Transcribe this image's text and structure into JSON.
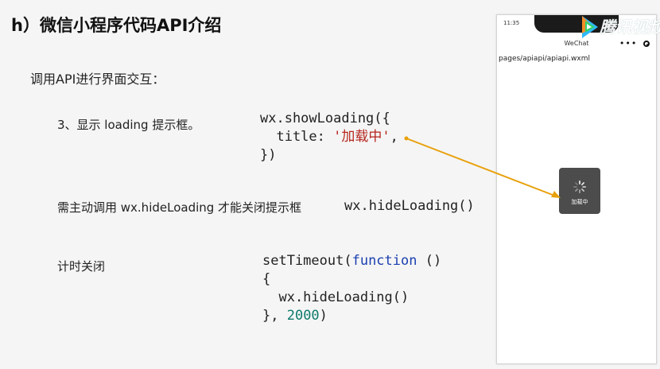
{
  "slide": {
    "title": "h）微信小程序代码API介绍",
    "subtitle": "调用API进行界面交互：",
    "items": [
      {
        "label": "3、显示 loading 提示框。"
      },
      {
        "label": "需主动调用 wx.hideLoading 才能关闭提示框"
      },
      {
        "label": "计时关闭"
      }
    ],
    "code": {
      "show_loading_l1": "wx.showLoading({",
      "show_loading_l2_key": "  title: ",
      "show_loading_l2_val": "'加载中'",
      "show_loading_l2_end": ",",
      "show_loading_l3": "})",
      "hide_loading": "wx.hideLoading()",
      "timeout_l1_a": "setTimeout(",
      "timeout_l1_kw": "function",
      "timeout_l1_b": " ()",
      "timeout_l2": "{",
      "timeout_l3": "  wx.hideLoading()",
      "timeout_l4_a": "}, ",
      "timeout_l4_num": "2000",
      "timeout_l4_b": ")"
    }
  },
  "phone": {
    "time": "11:35",
    "nav_title": "WeChat",
    "path": "pages/apiapi/apiapi.wxml",
    "toast_text": "加载中"
  },
  "watermark": {
    "text": "腾讯视频"
  },
  "colors": {
    "arrow": "#e8a10c",
    "code_string": "#b5261e",
    "code_keyword": "#1a3fb0",
    "code_number": "#0e7a6b",
    "toast_bg": "#4c4c4c"
  },
  "icons": {
    "capsule_menu": "more-dots-icon",
    "capsule_close": "record-circle-icon",
    "toast_spinner": "loading-spinner-icon",
    "logo": "tencent-video-logo-icon"
  }
}
